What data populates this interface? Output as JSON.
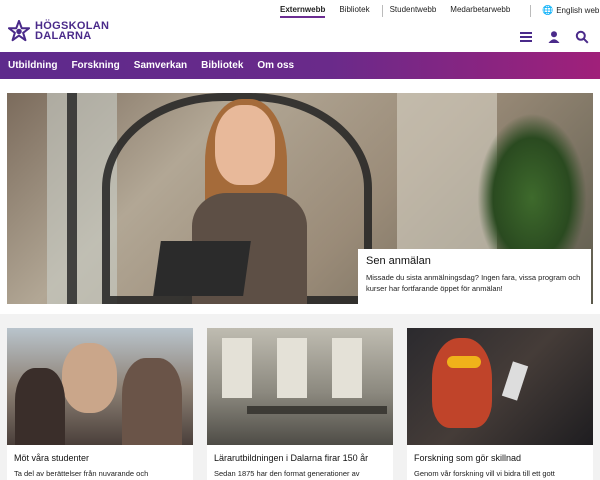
{
  "brand": {
    "line1": "HÖGSKOLAN",
    "line2": "DALARNA",
    "accent": "#5e2a8c"
  },
  "toplinks": {
    "externwebb": "Externwebb",
    "bibliotek": "Bibliotek",
    "studentwebb": "Studentwebb",
    "medarbetarwebb": "Medarbetarwebb",
    "english": "English web"
  },
  "icons": [
    "menu-icon",
    "user-icon",
    "search-icon"
  ],
  "nav": [
    "Utbildning",
    "Forskning",
    "Samverkan",
    "Bibliotek",
    "Om oss"
  ],
  "hero": {
    "title": "Sen anmälan",
    "text": "Missade du sista anmälningsdag? Ingen fara, vissa program och kurser har fortfarande öppet för anmälan!"
  },
  "cards": [
    {
      "title": "Möt våra studenter",
      "text": "Ta del av berättelser från nuvarande och"
    },
    {
      "title": "Lärarutbildningen i Dalarna firar 150 år",
      "text": "Sedan 1875 har den format generationer av"
    },
    {
      "title": "Forskning som gör skillnad",
      "text": "Genom vår forskning vill vi bidra till ett gott"
    }
  ]
}
